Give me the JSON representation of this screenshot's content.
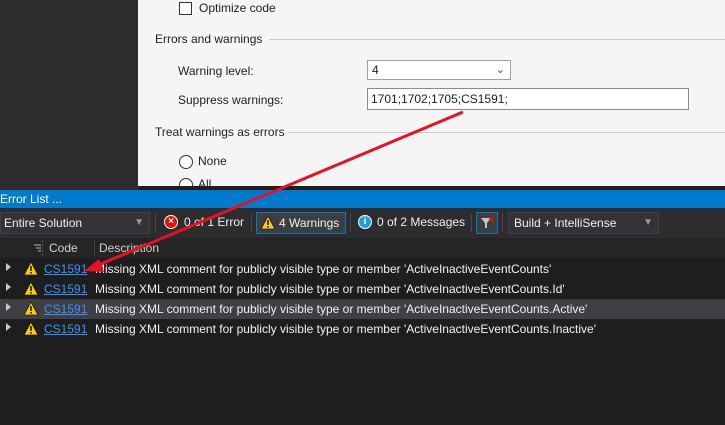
{
  "build": {
    "optimize_code_label": "Optimize code",
    "errors_section_label": "Errors and warnings",
    "warning_level_label": "Warning level:",
    "warning_level_value": "4",
    "suppress_label": "Suppress warnings:",
    "suppress_value": "1701;1702;1705;CS1591;",
    "treat_section_label": "Treat warnings as errors",
    "none_label": "None",
    "all_label": "All"
  },
  "error_list": {
    "title": "Error List ...",
    "scope": "Entire Solution",
    "errors_label": "0 of 1 Error",
    "warnings_label": "4 Warnings",
    "messages_label": "0 of 2 Messages",
    "source": "Build + IntelliSense",
    "columns": {
      "code": "Code",
      "description": "Description"
    },
    "rows": [
      {
        "code": "CS1591",
        "description": "Missing XML comment for publicly visible type or member 'ActiveInactiveEventCounts'"
      },
      {
        "code": "CS1591",
        "description": "Missing XML comment for publicly visible type or member 'ActiveInactiveEventCounts.Id'"
      },
      {
        "code": "CS1591",
        "description": "Missing XML comment for publicly visible type or member 'ActiveInactiveEventCounts.Active'"
      },
      {
        "code": "CS1591",
        "description": "Missing XML comment for publicly visible type or member 'ActiveInactiveEventCounts.Inactive'"
      }
    ]
  },
  "colors": {
    "accent": "#007acc",
    "warning": "#ffcc00",
    "error": "#e51400",
    "link": "#3794ff",
    "annotation_arrow": "#e81123"
  },
  "icons": [
    "error-icon",
    "warning-icon",
    "info-icon",
    "filter-icon",
    "expand-icon",
    "chevron-down-icon"
  ]
}
